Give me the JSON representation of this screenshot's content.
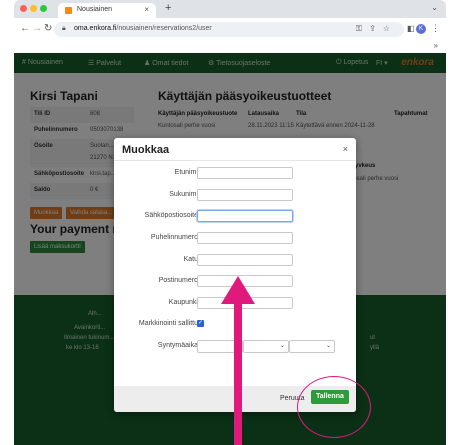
{
  "browser": {
    "tab_title": "Nousiainen",
    "tab_close": "×",
    "new_tab": "+",
    "url_domain": "oma.enkora.fi",
    "url_path": "/nousiainen/reservations2/user",
    "avatar_letter": "K"
  },
  "topnav": {
    "items": [
      "# Nousiainen",
      "☰ Palvelut",
      "♟ Omat tiedot",
      "⚙ Tietosuojaseloste"
    ],
    "logout": "⏻ Lopetus",
    "lang": "FI ▾",
    "logo": "enkora"
  },
  "profile": {
    "name": "Kirsi Tapani",
    "rows": [
      {
        "label": "Tili ID",
        "value": "608"
      },
      {
        "label": "Puhelinnumero",
        "value": "0503070138"
      },
      {
        "label": "Osoite",
        "value": "Suolan..."
      },
      {
        "label": "",
        "value": "21270 N..."
      },
      {
        "label": "Sähköpostiosoite",
        "value": "kirsi.tap..."
      },
      {
        "label": "Saldo",
        "value": "0 €"
      }
    ],
    "edit_button": "Muokkaa",
    "password_button": "Vaihda salasa..."
  },
  "rights": {
    "title": "Käyttäjän pääsyoikeustuotteet",
    "columns": [
      "Käyttäjän pääsyoikeustuote",
      "Lataus­aika",
      "Tila",
      "Tapahtumat"
    ],
    "row": [
      "Kuntosali perhe vuosi",
      "28.11.2023 11:15",
      "Käytettävä ennen 2024-11-28",
      ""
    ],
    "side_title": "Pääsyvkeus",
    "side_value": "Kuntosali perhe vuosi"
  },
  "payment": {
    "title": "Your payment m...",
    "add_button": "Lisää maksukortti"
  },
  "footer": {
    "lines": [
      "Alh...",
      "Avainkorti...",
      "Ilmainen tukinum...",
      "ke klo 13-16",
      "ut",
      "yllä"
    ]
  },
  "modal": {
    "title": "Muokkaa",
    "close": "×",
    "fields": [
      {
        "label": "Etunimi",
        "value": ""
      },
      {
        "label": "Sukunimi",
        "value": ""
      },
      {
        "label": "Sähköpostiosoite",
        "value": ""
      },
      {
        "label": "Puhelinnumero",
        "value": ""
      },
      {
        "label": "Katu",
        "value": ""
      },
      {
        "label": "Postinumero",
        "value": ""
      },
      {
        "label": "Kaupunki",
        "value": ""
      }
    ],
    "marketing_label": "Markkinointi sallittu",
    "marketing_checked": true,
    "birthdate_label": "Syntymäaika",
    "cancel": "Peruuta",
    "save": "Tallenna"
  },
  "colors": {
    "nav_green": "#17612d",
    "button_green": "#2f9a3a",
    "accent_orange": "#e07b2a",
    "annotation_pink": "#e0197d"
  }
}
